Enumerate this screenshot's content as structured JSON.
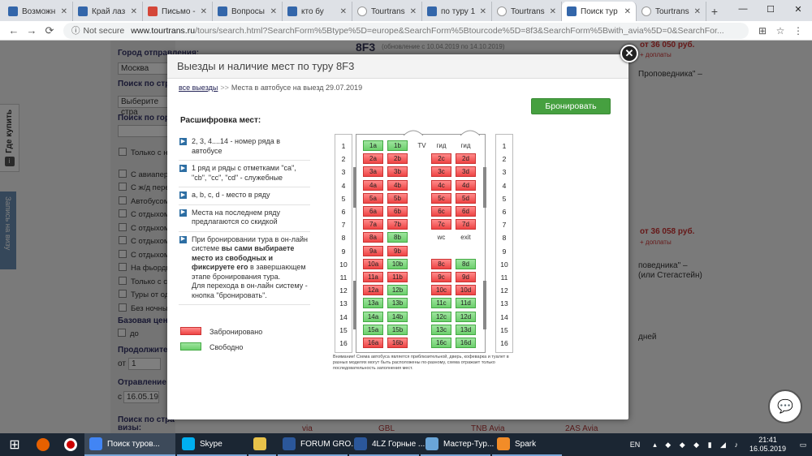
{
  "browser": {
    "tabs": [
      {
        "title": "Возможн",
        "icon": "w"
      },
      {
        "title": "Край лаз",
        "icon": "w"
      },
      {
        "title": "Письмо -",
        "icon": "m"
      },
      {
        "title": "Вопросы",
        "icon": "w"
      },
      {
        "title": "кто бу",
        "icon": "w"
      },
      {
        "title": "Tourtrans",
        "icon": "g"
      },
      {
        "title": "по туру 1",
        "icon": "w"
      },
      {
        "title": "Tourtrans",
        "icon": "g"
      },
      {
        "title": "Поиск тур",
        "icon": "w",
        "active": true
      },
      {
        "title": "Tourtrans",
        "icon": "g"
      }
    ],
    "not_secure": "Not secure",
    "url_domain": "www.tourtrans.ru",
    "url_path": "/tours/search.html?SearchForm%5Btype%5D=europe&SearchForm%5Btourcode%5D=8f3&SearchForm%5Bwith_avia%5D=0&SearchFor..."
  },
  "background_page": {
    "labels": {
      "city_from": "Город отправления:",
      "city_value": "Москва",
      "search_country": "Поиск по стра",
      "choose_country": "Выберите стра",
      "search_city": "Поиск по город",
      "price": "Базовая цена",
      "price_from": "до",
      "duration": "Продолжитель",
      "duration_from": "от",
      "duration_val": "1",
      "departure": "Отравление в",
      "departure_from": "с",
      "departure_date": "16.05.19",
      "search_country2": "Поиск по стра",
      "visas": "визы:",
      "code": "8F3",
      "tour_subtitle": "(обновление с 10.04.2019 по 14.10.2019)",
      "price1": "от 36 050 руб.",
      "price1_sub": "+ доплаты",
      "price2": "от 36 058 руб.",
      "price2_sub": "+ доплаты",
      "text1": "Проповедника\" –",
      "text2": "поведника\" –",
      "text3": "(или Стегастейн)",
      "text4": "дней",
      "bottom": [
        "via",
        "GBL",
        "TNB Avia",
        "2AS Avia"
      ]
    },
    "checkboxes": [
      "Только с нал",
      "С авиаперел",
      "С ж/д перева",
      "Автобусом и",
      "С отдыхом н",
      "С отдыхом н",
      "С отдыхом н",
      "С отдыхом в",
      "На фьорды",
      "Только с сопр",
      "Туры от одно",
      "Без ночных п"
    ],
    "side_tab": "Где купить",
    "side_tab2": "Запись на визу"
  },
  "modal": {
    "title": "Выезды и наличие мест по туру 8F3",
    "breadcrumb_link": "все выезды",
    "breadcrumb_sep": ">>",
    "breadcrumb_current": "Места в автобусе на выезд 29.07.2019",
    "book_button": "Бронировать",
    "legend_title": "Расшифровка мест:",
    "legend_items": [
      {
        "text": "2, 3, 4....14 - номер ряда в автобусе"
      },
      {
        "text": "1 ряд и ряды с отметками \"ca\", \"cb\", \"cc\", \"cd\" - служебные"
      },
      {
        "text": "a, b, c, d - место в ряду"
      },
      {
        "text": "Места на последнем ряду предлагаются со скидкой"
      },
      {
        "text_parts": [
          "При бронировании тура в он-лайн системе ",
          "вы сами выбираете место из свободных и фиксируете его",
          " в завершающем этапе бронирования тура.",
          "Для перехода в он-лайн систему - кнопка \"бронировать\"."
        ]
      }
    ],
    "legend_booked": "Забронировано",
    "legend_free": "Свободно",
    "colors": {
      "booked": "#ee4444",
      "free": "#6ccf6c",
      "button": "#46a040"
    },
    "row_numbers": [
      "1",
      "2",
      "3",
      "4",
      "5",
      "6",
      "7",
      "8",
      "9",
      "10",
      "11",
      "12",
      "13",
      "14",
      "15",
      "16"
    ],
    "front_labels": [
      "TV",
      "гид",
      "гид"
    ],
    "middle_labels": [
      "wc",
      "exit"
    ],
    "seats": [
      {
        "id": "1a",
        "s": "f"
      },
      {
        "id": "1b",
        "s": "f"
      },
      {
        "id": "2a",
        "s": "b"
      },
      {
        "id": "2b",
        "s": "b"
      },
      {
        "id": "2c",
        "s": "b"
      },
      {
        "id": "2d",
        "s": "b"
      },
      {
        "id": "3a",
        "s": "b"
      },
      {
        "id": "3b",
        "s": "b"
      },
      {
        "id": "3c",
        "s": "b"
      },
      {
        "id": "3d",
        "s": "b"
      },
      {
        "id": "4a",
        "s": "b"
      },
      {
        "id": "4b",
        "s": "b"
      },
      {
        "id": "4c",
        "s": "b"
      },
      {
        "id": "4d",
        "s": "b"
      },
      {
        "id": "5a",
        "s": "b"
      },
      {
        "id": "5b",
        "s": "b"
      },
      {
        "id": "5c",
        "s": "b"
      },
      {
        "id": "5d",
        "s": "b"
      },
      {
        "id": "6a",
        "s": "b"
      },
      {
        "id": "6b",
        "s": "b"
      },
      {
        "id": "6c",
        "s": "b"
      },
      {
        "id": "6d",
        "s": "b"
      },
      {
        "id": "7a",
        "s": "b"
      },
      {
        "id": "7b",
        "s": "b"
      },
      {
        "id": "7c",
        "s": "b"
      },
      {
        "id": "7d",
        "s": "b"
      },
      {
        "id": "8a",
        "s": "b"
      },
      {
        "id": "8b",
        "s": "f"
      },
      {
        "id": "9a",
        "s": "b"
      },
      {
        "id": "9b",
        "s": "b"
      },
      {
        "id": "10a",
        "s": "b"
      },
      {
        "id": "10b",
        "s": "f"
      },
      {
        "id": "8c",
        "s": "b"
      },
      {
        "id": "8d",
        "s": "f"
      },
      {
        "id": "11a",
        "s": "b"
      },
      {
        "id": "11b",
        "s": "b"
      },
      {
        "id": "9c",
        "s": "b"
      },
      {
        "id": "9d",
        "s": "b"
      },
      {
        "id": "12a",
        "s": "b"
      },
      {
        "id": "12b",
        "s": "f"
      },
      {
        "id": "10c",
        "s": "b"
      },
      {
        "id": "10d",
        "s": "b"
      },
      {
        "id": "13a",
        "s": "f"
      },
      {
        "id": "13b",
        "s": "f"
      },
      {
        "id": "11c",
        "s": "f"
      },
      {
        "id": "11d",
        "s": "f"
      },
      {
        "id": "14a",
        "s": "f"
      },
      {
        "id": "14b",
        "s": "f"
      },
      {
        "id": "12c",
        "s": "f"
      },
      {
        "id": "12d",
        "s": "f"
      },
      {
        "id": "15a",
        "s": "f"
      },
      {
        "id": "15b",
        "s": "f"
      },
      {
        "id": "13c",
        "s": "f"
      },
      {
        "id": "13d",
        "s": "f"
      },
      {
        "id": "16a",
        "s": "b"
      },
      {
        "id": "16b",
        "s": "b"
      },
      {
        "id": "16c",
        "s": "f"
      },
      {
        "id": "16d",
        "s": "f"
      }
    ],
    "note": "Внимание! Схема автобуса является приблизительной, дверь, кофеварка и туалет в разных моделях могут быть расположены по-разному, схема отражает только последовательность заполнения мест."
  },
  "taskbar": {
    "apps": [
      {
        "label": "Поиск туров...",
        "icon": "chrome-icon",
        "active": true
      },
      {
        "label": "Skype",
        "icon": "skype-icon"
      },
      {
        "label": "",
        "icon": "explorer-icon"
      },
      {
        "label": "FORUM GRO...",
        "icon": "word-icon"
      },
      {
        "label": "4LZ Горные ...",
        "icon": "word-icon"
      },
      {
        "label": "Мастер-Тур...",
        "icon": "mastertour-icon"
      },
      {
        "label": "Spark",
        "icon": "spark-icon"
      }
    ],
    "lang": "EN",
    "time": "21:41",
    "date": "16.05.2019"
  }
}
